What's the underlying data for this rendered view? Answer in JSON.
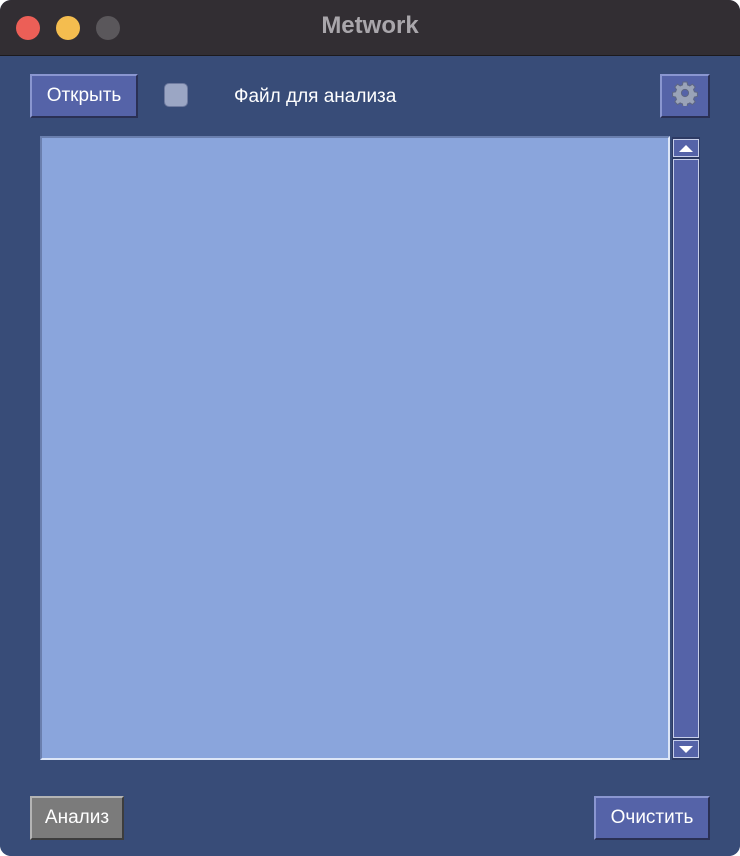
{
  "window": {
    "title": "Metwork"
  },
  "toolbar": {
    "open_label": "Открыть",
    "file_label": "Файл для анализа",
    "file_checkbox_checked": false,
    "settings_icon": "gear-icon"
  },
  "footer": {
    "analyze_label": "Анализ",
    "clear_label": "Очистить"
  },
  "text_area": {
    "value": ""
  },
  "colors": {
    "window_bg": "#384c78",
    "titlebar_bg": "#322e33",
    "button_bg": "#5563a8",
    "analyze_button_bg": "#7b7b7b",
    "text_area_bg": "#8aa5dc"
  }
}
